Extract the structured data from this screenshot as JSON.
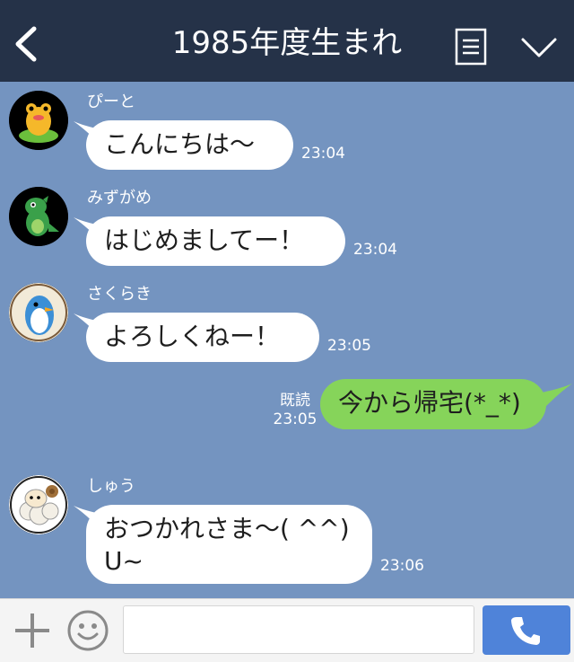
{
  "header": {
    "title": "1985年度生まれ",
    "back_icon": "chevron-left-icon",
    "menu_icon": "list-icon",
    "expand_icon": "chevron-down-icon",
    "bg_color": "#253248"
  },
  "chat": {
    "bg_color": "#7494c0",
    "messages": [
      {
        "sender": "ぴーと",
        "text": "こんにちは〜",
        "time": "23:04",
        "avatar": "frog-avatar"
      },
      {
        "sender": "みずがめ",
        "text": "はじめましてー！",
        "time": "23:04",
        "avatar": "dinosaur-avatar"
      },
      {
        "sender": "さくらき",
        "text": "よろしくねー！",
        "time": "23:05",
        "avatar": "penguin-avatar"
      },
      {
        "sender": "",
        "text": "今から帰宅(*_*)",
        "time": "23:05",
        "read": "既読",
        "outgoing": true
      },
      {
        "sender": "しゅう",
        "text_line1": "おつかれさま〜( ^^)",
        "text_line2": "U~",
        "time": "23:06",
        "avatar": "sheep-avatar"
      }
    ],
    "incoming_bubble_color": "#ffffff",
    "outgoing_bubble_color": "#86d45a"
  },
  "footer": {
    "plus_icon": "plus-icon",
    "emoji_icon": "smiley-icon",
    "input_value": "",
    "call_icon": "phone-icon",
    "call_color": "#4f83d9"
  }
}
